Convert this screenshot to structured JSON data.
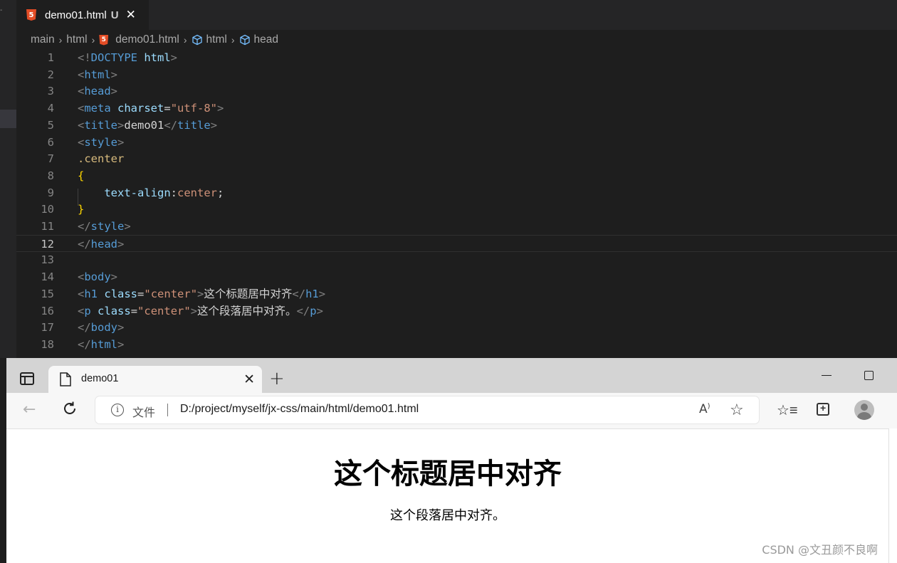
{
  "editor": {
    "tab": {
      "filename": "demo01.html",
      "status": "U"
    },
    "breadcrumb": [
      "main",
      "html",
      "demo01.html",
      "html",
      "head"
    ],
    "lines": [
      {
        "n": "1",
        "tokens": [
          [
            "punc",
            "<!"
          ],
          [
            "tag",
            "DOCTYPE"
          ],
          [
            "text",
            " "
          ],
          [
            "attr",
            "html"
          ],
          [
            "punc",
            ">"
          ]
        ]
      },
      {
        "n": "2",
        "tokens": [
          [
            "punc",
            "<"
          ],
          [
            "tag",
            "html"
          ],
          [
            "punc",
            ">"
          ]
        ]
      },
      {
        "n": "3",
        "tokens": [
          [
            "punc",
            "<"
          ],
          [
            "tag",
            "head"
          ],
          [
            "punc",
            ">"
          ]
        ]
      },
      {
        "n": "4",
        "tokens": [
          [
            "punc",
            "<"
          ],
          [
            "tag",
            "meta"
          ],
          [
            "text",
            " "
          ],
          [
            "attr",
            "charset"
          ],
          [
            "text",
            "="
          ],
          [
            "str",
            "\"utf-8\""
          ],
          [
            "punc",
            ">"
          ]
        ]
      },
      {
        "n": "5",
        "tokens": [
          [
            "punc",
            "<"
          ],
          [
            "tag",
            "title"
          ],
          [
            "punc",
            ">"
          ],
          [
            "text",
            "demo01"
          ],
          [
            "punc",
            "</"
          ],
          [
            "tag",
            "title"
          ],
          [
            "punc",
            ">"
          ]
        ]
      },
      {
        "n": "6",
        "tokens": [
          [
            "punc",
            "<"
          ],
          [
            "tag",
            "style"
          ],
          [
            "punc",
            ">"
          ]
        ]
      },
      {
        "n": "7",
        "tokens": [
          [
            "sel",
            ".center"
          ]
        ]
      },
      {
        "n": "8",
        "tokens": [
          [
            "brace",
            "{"
          ]
        ]
      },
      {
        "n": "9",
        "tokens": [
          [
            "text",
            "    "
          ],
          [
            "prop",
            "text-align"
          ],
          [
            "text",
            ":"
          ],
          [
            "str",
            "center"
          ],
          [
            "text",
            ";"
          ]
        ]
      },
      {
        "n": "10",
        "tokens": [
          [
            "brace",
            "}"
          ]
        ]
      },
      {
        "n": "11",
        "tokens": [
          [
            "punc",
            "</"
          ],
          [
            "tag",
            "style"
          ],
          [
            "punc",
            ">"
          ]
        ]
      },
      {
        "n": "12",
        "tokens": [
          [
            "punc",
            "</"
          ],
          [
            "tag",
            "head"
          ],
          [
            "punc",
            ">"
          ]
        ],
        "current": true
      },
      {
        "n": "13",
        "tokens": []
      },
      {
        "n": "14",
        "tokens": [
          [
            "punc",
            "<"
          ],
          [
            "tag",
            "body"
          ],
          [
            "punc",
            ">"
          ]
        ]
      },
      {
        "n": "15",
        "tokens": [
          [
            "punc",
            "<"
          ],
          [
            "tag",
            "h1"
          ],
          [
            "text",
            " "
          ],
          [
            "attr",
            "class"
          ],
          [
            "text",
            "="
          ],
          [
            "str",
            "\"center\""
          ],
          [
            "punc",
            ">"
          ],
          [
            "text",
            "这个标题居中对齐"
          ],
          [
            "punc",
            "</"
          ],
          [
            "tag",
            "h1"
          ],
          [
            "punc",
            ">"
          ]
        ]
      },
      {
        "n": "16",
        "tokens": [
          [
            "punc",
            "<"
          ],
          [
            "tag",
            "p"
          ],
          [
            "text",
            " "
          ],
          [
            "attr",
            "class"
          ],
          [
            "text",
            "="
          ],
          [
            "str",
            "\"center\""
          ],
          [
            "punc",
            ">"
          ],
          [
            "text",
            "这个段落居中对齐。"
          ],
          [
            "punc",
            "</"
          ],
          [
            "tag",
            "p"
          ],
          [
            "punc",
            ">"
          ]
        ]
      },
      {
        "n": "17",
        "tokens": [
          [
            "punc",
            "</"
          ],
          [
            "tag",
            "body"
          ],
          [
            "punc",
            ">"
          ]
        ]
      },
      {
        "n": "18",
        "tokens": [
          [
            "punc",
            "</"
          ],
          [
            "tag",
            "html"
          ],
          [
            "punc",
            ">"
          ]
        ]
      }
    ]
  },
  "browser": {
    "tab_title": "demo01",
    "address": {
      "label": "文件",
      "url": "D:/project/myself/jx-css/main/html/demo01.html"
    },
    "page": {
      "heading": "这个标题居中对齐",
      "paragraph": "这个段落居中对齐。"
    },
    "watermark": "CSDN @文丑颜不良啊"
  }
}
